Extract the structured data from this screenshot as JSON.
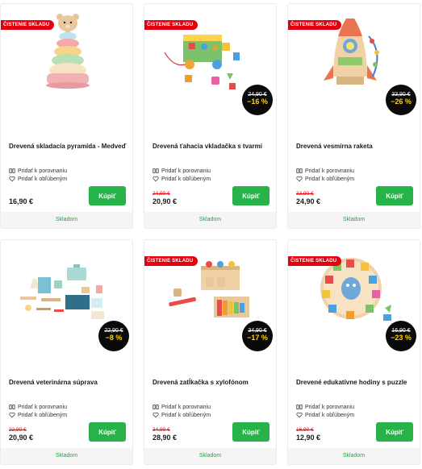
{
  "labels": {
    "compare": "Pridať k porovnaniu",
    "favorite": "Pridať k obľúbeným",
    "buy": "Kúpiť",
    "clearance": "ČISTENIE SKLADU"
  },
  "products": [
    {
      "title": "Drevená skladacia pyramída - Medveď",
      "price": "16,90 €",
      "old_price": "",
      "discount": "",
      "clearance": true,
      "stock": "Skladom",
      "image_icon": "bear-stacking-pyramid-image"
    },
    {
      "title": "Drevená ťahacia vkladačka s tvarmi",
      "price": "20,90 €",
      "old_price": "24,90 €",
      "discount": "−16 %",
      "clearance": true,
      "stock": "Skladom",
      "image_icon": "shape-sorter-cart-image"
    },
    {
      "title": "Drevená vesmírna raketa",
      "price": "24,90 €",
      "old_price": "33,90 €",
      "discount": "−26 %",
      "clearance": true,
      "stock": "Skladom",
      "image_icon": "wooden-rocket-image"
    },
    {
      "title": "Drevená veterinárna súprava",
      "price": "20,90 €",
      "old_price": "22,90 €",
      "discount": "−8 %",
      "clearance": false,
      "stock": "Skladom",
      "image_icon": "vet-kit-image"
    },
    {
      "title": "Drevená zatĺkačka s xylofónom",
      "price": "28,90 €",
      "old_price": "34,90 €",
      "discount": "−17 %",
      "clearance": true,
      "stock": "Skladom",
      "image_icon": "pound-bench-xylophone-image"
    },
    {
      "title": "Drevené edukatívne hodiny s puzzle",
      "price": "12,90 €",
      "old_price": "16,90 €",
      "discount": "−23 %",
      "clearance": true,
      "stock": "Skladom",
      "image_icon": "puzzle-clock-image"
    }
  ],
  "colors": {
    "accent_green": "#27b34a",
    "clearance_red": "#e3000f",
    "discount_yellow": "#ffd400"
  }
}
